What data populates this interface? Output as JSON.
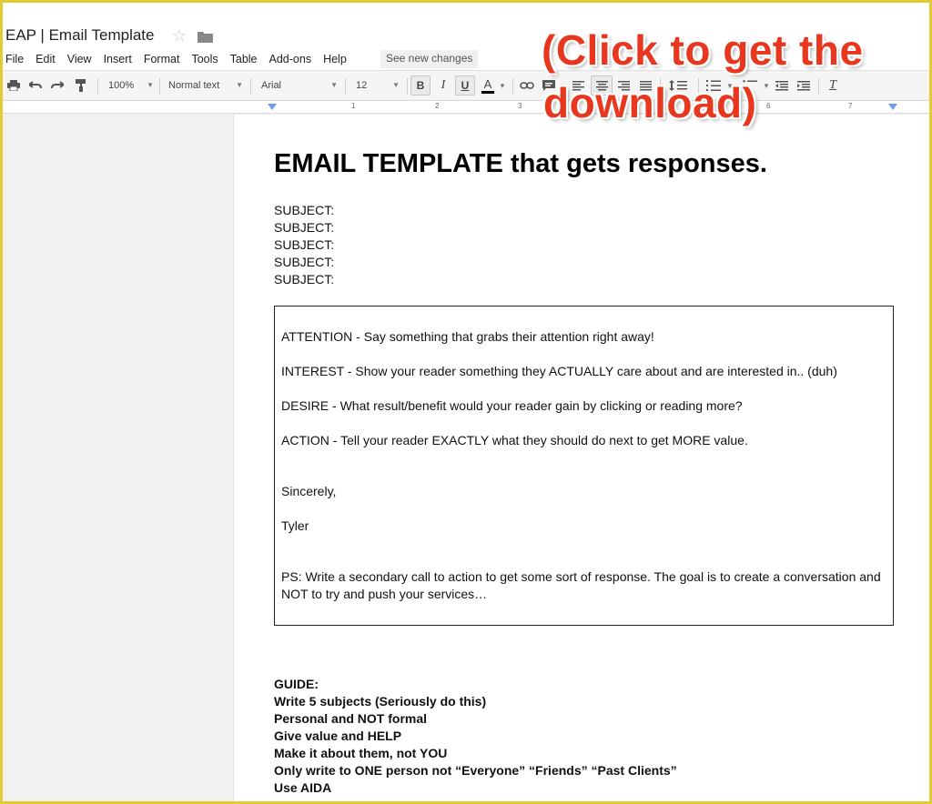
{
  "app": {
    "doc_title": "EAP | Email Template",
    "see_new_changes": "See new changes"
  },
  "menu": [
    "File",
    "Edit",
    "View",
    "Insert",
    "Format",
    "Tools",
    "Table",
    "Add-ons",
    "Help"
  ],
  "toolbar": {
    "zoom": "100%",
    "style": "Normal text",
    "font": "Arial",
    "size": "12",
    "bold": "B",
    "italic": "I",
    "underline": "U",
    "text_color": "A",
    "clear_format": "T"
  },
  "ruler": [
    "1",
    "2",
    "3",
    "6",
    "7"
  ],
  "document": {
    "heading": "EMAIL TEMPLATE that gets responses.",
    "subjects": [
      "SUBJECT:",
      "SUBJECT:",
      "SUBJECT:",
      "SUBJECT:",
      "SUBJECT:"
    ],
    "box": {
      "attention": "ATTENTION - Say something that grabs their attention right away!",
      "interest": "INTEREST - Show your reader something they ACTUALLY care about and are interested in.. (duh)",
      "desire": "DESIRE - What result/benefit would your reader gain by clicking or reading more?",
      "action": "ACTION - Tell your reader EXACTLY what they should do next to get MORE value.",
      "sincerely": "Sincerely,",
      "name": "Tyler",
      "ps": "PS: Write a secondary call to action to get some sort of response. The goal is to create a conversation and NOT to try and push your services…"
    },
    "guide": [
      "GUIDE:",
      "Write 5 subjects (Seriously do this)",
      "Personal and NOT formal",
      "Give value and HELP",
      "Make it about them, not YOU",
      "Only write to ONE person not “Everyone” “Friends” “Past Clients”",
      "Use AIDA"
    ]
  },
  "overlay": {
    "line1": "(Click to get the",
    "line2": "download)"
  },
  "colors": {
    "frame": "#e2cb33",
    "overlay_text": "#e8371f",
    "ruler_marker": "#6e9ce6"
  }
}
